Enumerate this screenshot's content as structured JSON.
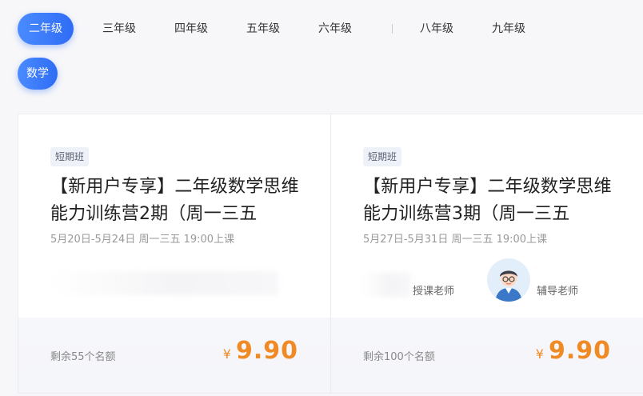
{
  "grades": [
    {
      "label": "二年级",
      "active": true
    },
    {
      "label": "三年级",
      "active": false
    },
    {
      "label": "四年级",
      "active": false
    },
    {
      "label": "五年级",
      "active": false
    },
    {
      "label": "六年级",
      "active": false
    },
    {
      "label": "八年级",
      "active": false
    },
    {
      "label": "九年级",
      "active": false
    }
  ],
  "subjects": [
    {
      "label": "数学",
      "active": true
    }
  ],
  "courses": [
    {
      "tag": "短期班",
      "title": "【新用户专享】二年级数学思维能力训练营2期（周一三五",
      "schedule": "5月20日-5月24日 周一三五 19:00上课",
      "remaining": "剩余55个名额",
      "currency": "¥",
      "price": "9.90"
    },
    {
      "tag": "短期班",
      "title": "【新用户专享】二年级数学思维能力训练营3期（周一三五",
      "schedule": "5月27日-5月31日 周一三五 19:00上课",
      "lecturer_label": "授课老师",
      "tutor_label": "辅导老师",
      "remaining": "剩余100个名额",
      "currency": "¥",
      "price": "9.90"
    }
  ],
  "colors": {
    "accent": "#2f6cf5",
    "price": "#f08a24"
  }
}
